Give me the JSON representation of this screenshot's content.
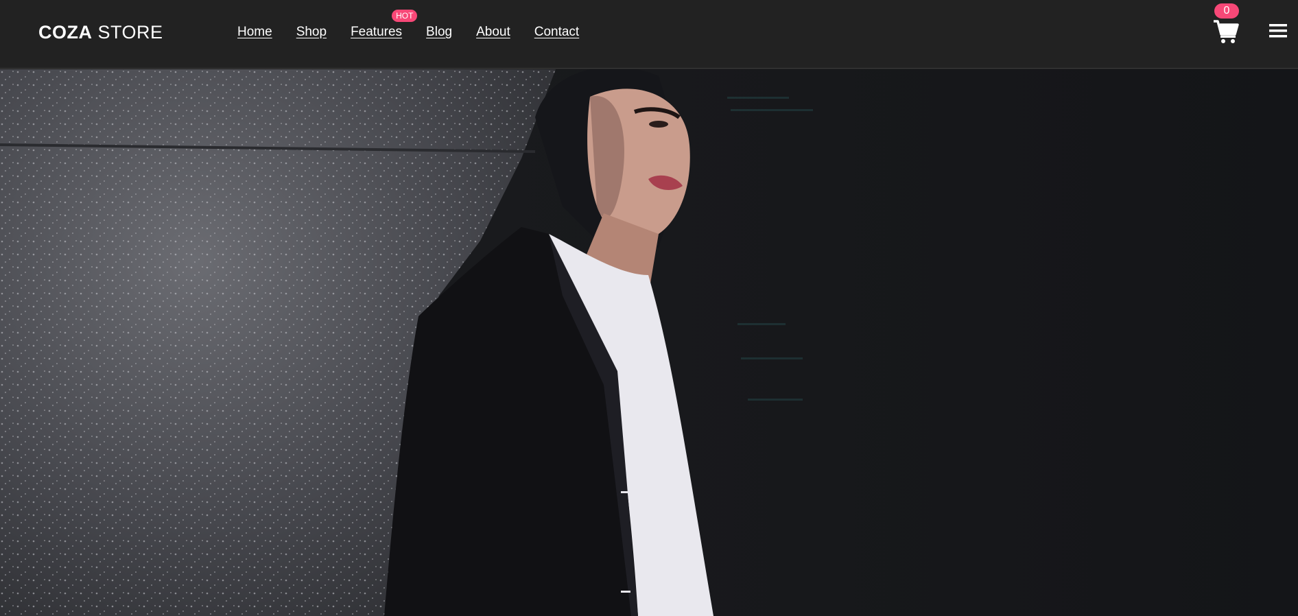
{
  "brand": {
    "logo_bold": "COZA",
    "logo_light": "STORE"
  },
  "nav": {
    "items": [
      {
        "label": "Home"
      },
      {
        "label": "Shop"
      },
      {
        "label": "Features",
        "badge": "HOT"
      },
      {
        "label": "Blog"
      },
      {
        "label": "About"
      },
      {
        "label": "Contact"
      }
    ]
  },
  "cart": {
    "count": "0",
    "icon": "shopping-cart-icon"
  },
  "menu": {
    "icon": "hamburger-menu-icon"
  },
  "hero": {
    "image": "hero-photo"
  },
  "colors": {
    "header_bg": "#222222",
    "accent": "#f74877",
    "text": "#ffffff"
  }
}
